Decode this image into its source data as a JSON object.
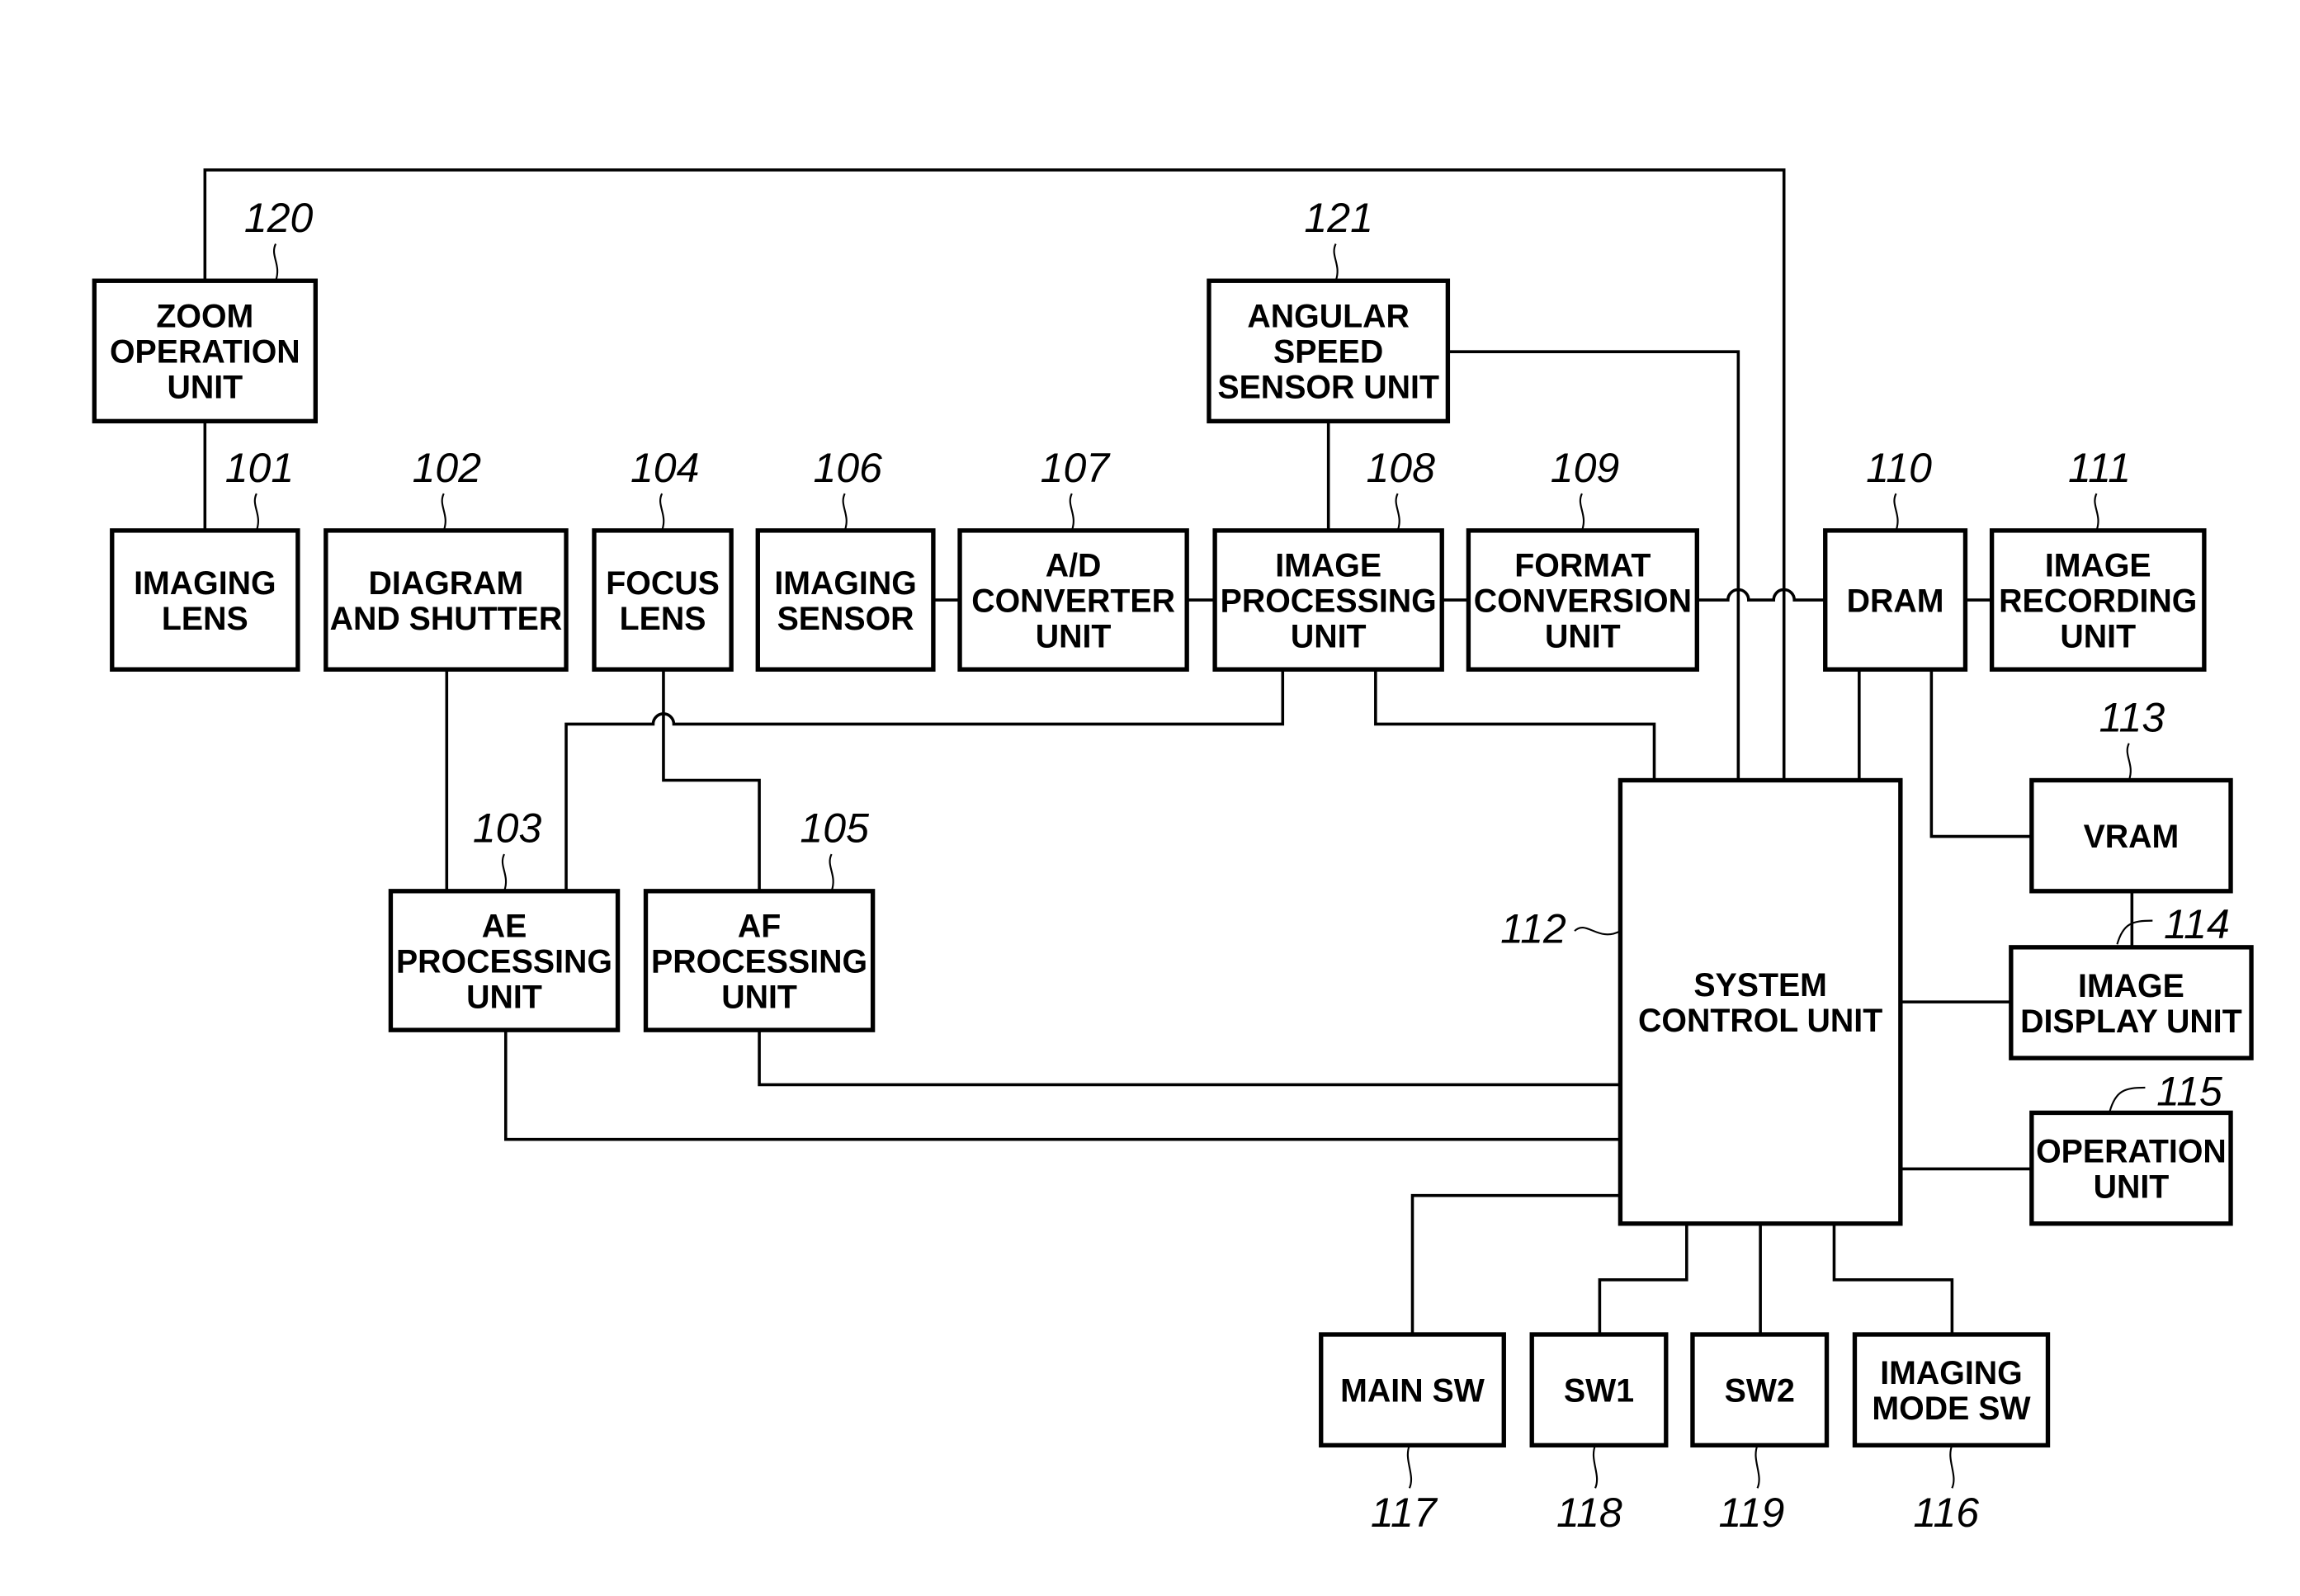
{
  "diagram": {
    "type": "block-diagram",
    "colors": {
      "line": "#000000",
      "background": "#ffffff"
    },
    "blocks": [
      {
        "id": "120",
        "ref": "120",
        "lines": [
          "ZOOM",
          "OPERATION",
          "UNIT"
        ]
      },
      {
        "id": "121",
        "ref": "121",
        "lines": [
          "ANGULAR",
          "SPEED",
          "SENSOR UNIT"
        ]
      },
      {
        "id": "101",
        "ref": "101",
        "lines": [
          "IMAGING",
          "LENS"
        ]
      },
      {
        "id": "102",
        "ref": "102",
        "lines": [
          "DIAGRAM",
          "AND SHUTTER"
        ]
      },
      {
        "id": "104",
        "ref": "104",
        "lines": [
          "FOCUS",
          "LENS"
        ]
      },
      {
        "id": "106",
        "ref": "106",
        "lines": [
          "IMAGING",
          "SENSOR"
        ]
      },
      {
        "id": "107",
        "ref": "107",
        "lines": [
          "A/D",
          "CONVERTER",
          "UNIT"
        ]
      },
      {
        "id": "108",
        "ref": "108",
        "lines": [
          "IMAGE",
          "PROCESSING",
          "UNIT"
        ]
      },
      {
        "id": "109",
        "ref": "109",
        "lines": [
          "FORMAT",
          "CONVERSION",
          "UNIT"
        ]
      },
      {
        "id": "110",
        "ref": "110",
        "lines": [
          "DRAM"
        ]
      },
      {
        "id": "111",
        "ref": "111",
        "lines": [
          "IMAGE",
          "RECORDING",
          "UNIT"
        ]
      },
      {
        "id": "113",
        "ref": "113",
        "lines": [
          "VRAM"
        ]
      },
      {
        "id": "114",
        "ref": "114",
        "lines": [
          "IMAGE",
          "DISPLAY UNIT"
        ]
      },
      {
        "id": "115",
        "ref": "115",
        "lines": [
          "OPERATION",
          "UNIT"
        ]
      },
      {
        "id": "103",
        "ref": "103",
        "lines": [
          "AE",
          "PROCESSING",
          "UNIT"
        ]
      },
      {
        "id": "105",
        "ref": "105",
        "lines": [
          "AF",
          "PROCESSING",
          "UNIT"
        ]
      },
      {
        "id": "112",
        "ref": "112",
        "lines": [
          "SYSTEM",
          "CONTROL UNIT"
        ]
      },
      {
        "id": "117",
        "ref": "117",
        "lines": [
          "MAIN SW"
        ]
      },
      {
        "id": "118",
        "ref": "118",
        "lines": [
          "SW1"
        ]
      },
      {
        "id": "119",
        "ref": "119",
        "lines": [
          "SW2"
        ]
      },
      {
        "id": "116",
        "ref": "116",
        "lines": [
          "IMAGING",
          "MODE SW"
        ]
      }
    ],
    "connections": [
      [
        "120",
        "101"
      ],
      [
        "120",
        "112"
      ],
      [
        "121",
        "108"
      ],
      [
        "121",
        "112"
      ],
      [
        "106",
        "107"
      ],
      [
        "107",
        "108"
      ],
      [
        "108",
        "109"
      ],
      [
        "109",
        "110"
      ],
      [
        "110",
        "111"
      ],
      [
        "110",
        "112"
      ],
      [
        "110",
        "113"
      ],
      [
        "113",
        "114"
      ],
      [
        "108",
        "103"
      ],
      [
        "108",
        "112"
      ],
      [
        "104",
        "105"
      ],
      [
        "102",
        "103"
      ],
      [
        "105",
        "112"
      ],
      [
        "103",
        "112"
      ],
      [
        "112",
        "114"
      ],
      [
        "112",
        "115"
      ],
      [
        "112",
        "117"
      ],
      [
        "112",
        "118"
      ],
      [
        "112",
        "119"
      ],
      [
        "112",
        "116"
      ]
    ]
  }
}
